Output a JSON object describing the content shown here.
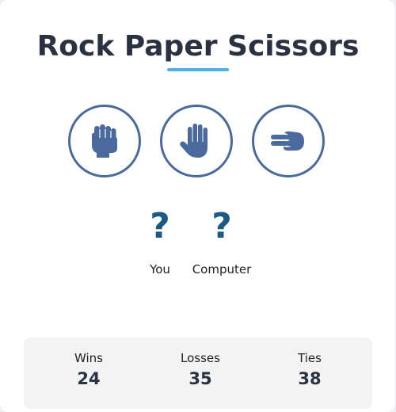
{
  "title": "Rock Paper Scissors",
  "choices": [
    {
      "name": "Rock",
      "icon": "rock-hand-icon"
    },
    {
      "name": "Paper",
      "icon": "paper-hand-icon"
    },
    {
      "name": "Scissors",
      "icon": "scissors-hand-icon"
    }
  ],
  "picks": {
    "you": {
      "symbol": "?",
      "label": "You"
    },
    "computer": {
      "symbol": "?",
      "label": "Computer"
    }
  },
  "scores": {
    "wins": {
      "label": "Wins",
      "value": "24"
    },
    "losses": {
      "label": "Losses",
      "value": "35"
    },
    "ties": {
      "label": "Ties",
      "value": "38"
    }
  },
  "colors": {
    "accent": "#4ab1e8",
    "icon": "#4a6a9d",
    "title": "#2a3141",
    "question_mark": "#1b5a84",
    "scores_bg": "#f3f3f4"
  }
}
